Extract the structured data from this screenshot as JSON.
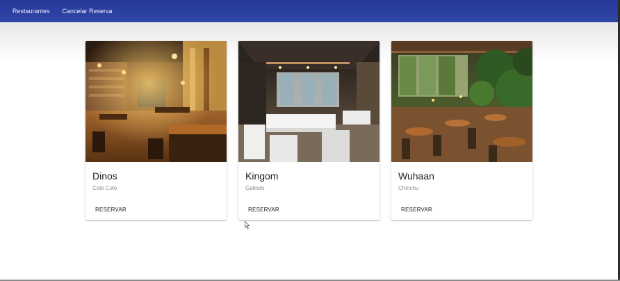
{
  "nav": {
    "items": [
      {
        "label": "Restaurantes"
      },
      {
        "label": "Cancelar Reserva"
      }
    ]
  },
  "colors": {
    "topbar": "#2b3f9f",
    "title": "#222222",
    "subtitle": "#8a8a8a"
  },
  "restaurants": [
    {
      "name": "Dinos",
      "location": "Colo Colo",
      "action": "RESERVAR",
      "image": "restaurant-interior-wood-photo"
    },
    {
      "name": "Kingom",
      "location": "Galindo",
      "action": "RESERVAR",
      "image": "restaurant-interior-white-chairs-photo"
    },
    {
      "name": "Wuhaan",
      "location": "Chinchu",
      "action": "RESERVAR",
      "image": "restaurant-terrace-plants-photo"
    }
  ]
}
